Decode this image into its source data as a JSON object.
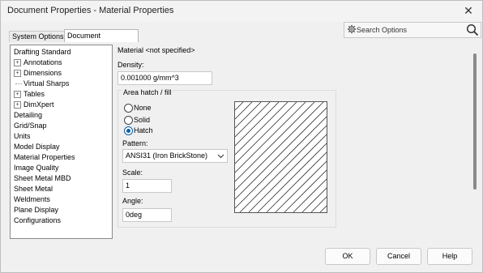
{
  "window": {
    "title": "Document Properties - Material Properties",
    "close_glyph": "✕"
  },
  "search": {
    "placeholder": "Search Options",
    "gear_icon": "gear-icon",
    "search_icon": "search-icon"
  },
  "tabs": [
    {
      "label": "System Options"
    },
    {
      "label": "Document Properties"
    }
  ],
  "tree": {
    "items": [
      {
        "label": "Drafting Standard",
        "level": 0,
        "expander": ""
      },
      {
        "label": "Annotations",
        "level": 1,
        "expander": "+"
      },
      {
        "label": "Dimensions",
        "level": 1,
        "expander": "+"
      },
      {
        "label": "Virtual Sharps",
        "level": 1,
        "expander": ""
      },
      {
        "label": "Tables",
        "level": 1,
        "expander": "+"
      },
      {
        "label": "DimXpert",
        "level": 1,
        "expander": "+"
      },
      {
        "label": "Detailing",
        "level": 0,
        "expander": ""
      },
      {
        "label": "Grid/Snap",
        "level": 0,
        "expander": ""
      },
      {
        "label": "Units",
        "level": 0,
        "expander": ""
      },
      {
        "label": "Model Display",
        "level": 0,
        "expander": ""
      },
      {
        "label": "Material Properties",
        "level": 0,
        "expander": ""
      },
      {
        "label": "Image Quality",
        "level": 0,
        "expander": ""
      },
      {
        "label": "Sheet Metal MBD",
        "level": 0,
        "expander": ""
      },
      {
        "label": "Sheet Metal",
        "level": 0,
        "expander": ""
      },
      {
        "label": "Weldments",
        "level": 0,
        "expander": ""
      },
      {
        "label": "Plane Display",
        "level": 0,
        "expander": ""
      },
      {
        "label": "Configurations",
        "level": 0,
        "expander": ""
      }
    ]
  },
  "material": {
    "label": "Material <not specified>",
    "density_label": "Density:",
    "density_value": "0.001000 g/mm^3"
  },
  "hatch": {
    "group_label": "Area hatch / fill",
    "options": [
      {
        "label": "None",
        "selected": false
      },
      {
        "label": "Solid",
        "selected": false
      },
      {
        "label": "Hatch",
        "selected": true
      }
    ],
    "pattern_label": "Pattern:",
    "pattern_value": "ANSI31 (Iron BrickStone)",
    "scale_label": "Scale:",
    "scale_value": "1",
    "angle_label": "Angle:",
    "angle_value": "0deg"
  },
  "buttons": {
    "ok": "OK",
    "cancel": "Cancel",
    "help": "Help"
  },
  "colors": {
    "accent": "#0a5ea8"
  }
}
